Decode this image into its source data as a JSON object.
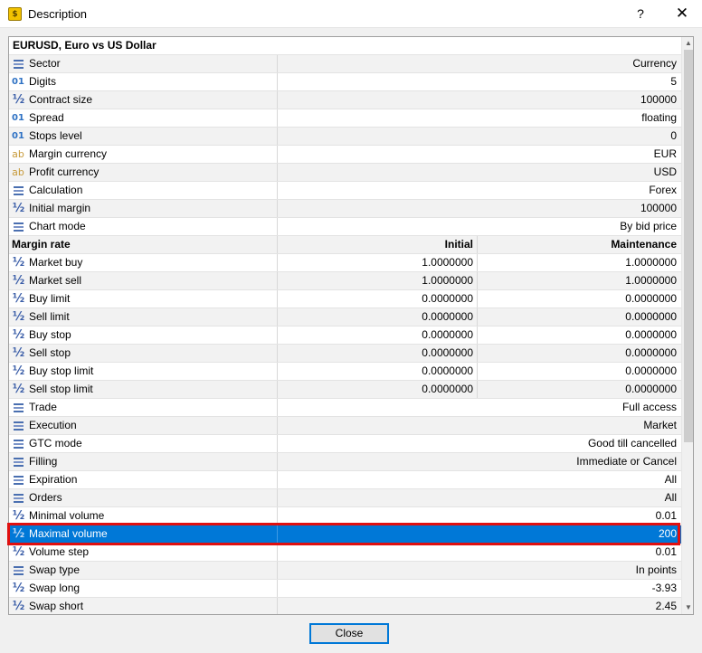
{
  "window": {
    "title": "Description",
    "help_label": "?",
    "close_label": "✕"
  },
  "symbol_title": "EURUSD, Euro vs US Dollar",
  "properties_top": [
    {
      "icon": "list-icon",
      "name": "Sector",
      "value": "Currency"
    },
    {
      "icon": "digits-icon",
      "name": "Digits",
      "value": "5"
    },
    {
      "icon": "fraction-icon",
      "name": "Contract size",
      "value": "100000"
    },
    {
      "icon": "digits-icon",
      "name": "Spread",
      "value": "floating"
    },
    {
      "icon": "digits-icon",
      "name": "Stops level",
      "value": "0"
    },
    {
      "icon": "text-icon",
      "name": "Margin currency",
      "value": "EUR"
    },
    {
      "icon": "text-icon",
      "name": "Profit currency",
      "value": "USD"
    },
    {
      "icon": "list-icon",
      "name": "Calculation",
      "value": "Forex"
    },
    {
      "icon": "fraction-icon",
      "name": "Initial margin",
      "value": "100000"
    },
    {
      "icon": "list-icon",
      "name": "Chart mode",
      "value": "By bid price"
    }
  ],
  "margin_rate": {
    "header": {
      "name": "Margin rate",
      "initial": "Initial",
      "maintenance": "Maintenance"
    },
    "rows": [
      {
        "name": "Market buy",
        "initial": "1.0000000",
        "maintenance": "1.0000000"
      },
      {
        "name": "Market sell",
        "initial": "1.0000000",
        "maintenance": "1.0000000"
      },
      {
        "name": "Buy limit",
        "initial": "0.0000000",
        "maintenance": "0.0000000"
      },
      {
        "name": "Sell limit",
        "initial": "0.0000000",
        "maintenance": "0.0000000"
      },
      {
        "name": "Buy stop",
        "initial": "0.0000000",
        "maintenance": "0.0000000"
      },
      {
        "name": "Sell stop",
        "initial": "0.0000000",
        "maintenance": "0.0000000"
      },
      {
        "name": "Buy stop limit",
        "initial": "0.0000000",
        "maintenance": "0.0000000"
      },
      {
        "name": "Sell stop limit",
        "initial": "0.0000000",
        "maintenance": "0.0000000"
      }
    ]
  },
  "properties_bottom": [
    {
      "icon": "list-icon",
      "name": "Trade",
      "value": "Full access"
    },
    {
      "icon": "list-icon",
      "name": "Execution",
      "value": "Market"
    },
    {
      "icon": "list-icon",
      "name": "GTC mode",
      "value": "Good till cancelled"
    },
    {
      "icon": "list-icon",
      "name": "Filling",
      "value": "Immediate or Cancel"
    },
    {
      "icon": "list-icon",
      "name": "Expiration",
      "value": "All"
    },
    {
      "icon": "list-icon",
      "name": "Orders",
      "value": "All"
    },
    {
      "icon": "fraction-icon",
      "name": "Minimal volume",
      "value": "0.01"
    },
    {
      "icon": "fraction-icon",
      "name": "Maximal volume",
      "value": "200",
      "selected": true
    },
    {
      "icon": "fraction-icon",
      "name": "Volume step",
      "value": "0.01"
    },
    {
      "icon": "list-icon",
      "name": "Swap type",
      "value": "In points"
    },
    {
      "icon": "fraction-icon",
      "name": "Swap long",
      "value": "-3.93"
    },
    {
      "icon": "fraction-icon",
      "name": "Swap short",
      "value": "2.45"
    }
  ],
  "buttons": {
    "close": "Close"
  },
  "colors": {
    "selection": "#0078d7",
    "highlight_border": "#e01010"
  }
}
